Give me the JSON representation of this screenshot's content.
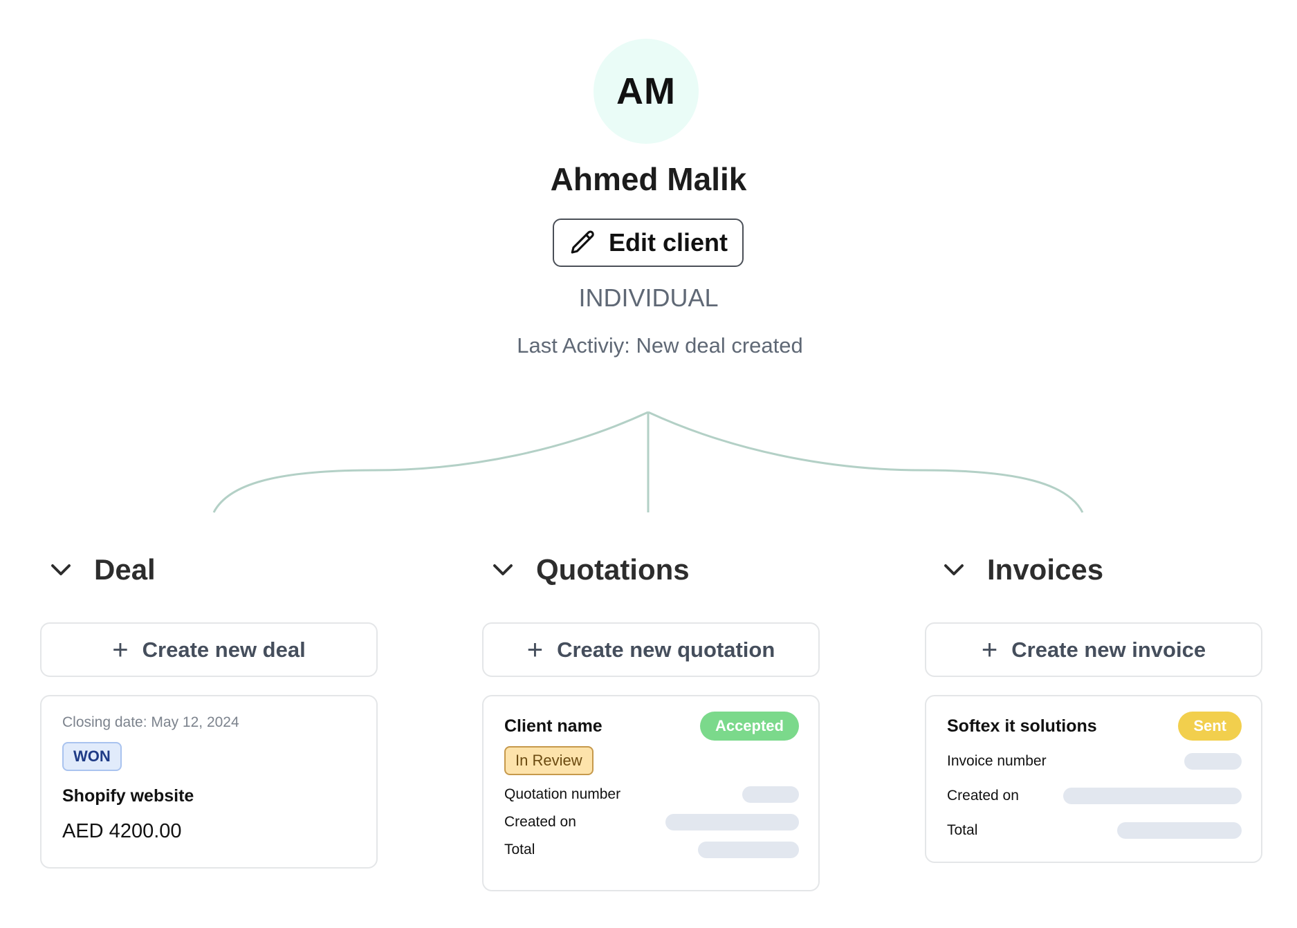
{
  "client": {
    "initials": "AM",
    "name": "Ahmed Malik",
    "edit_label": "Edit client",
    "type": "INDIVIDUAL",
    "last_activity": "Last Activiy: New deal created"
  },
  "colors": {
    "avatar_bg": "#eafcf7",
    "connector": "#b3d0c6",
    "accepted": "#7bd98b",
    "sent": "#f2cf4d",
    "in_review": "#fde3ab",
    "won": "#e1ebfb"
  },
  "deal": {
    "heading": "Deal",
    "create_label": "Create new deal",
    "card": {
      "closing_date": "Closing date: May 12, 2024",
      "status": "WON",
      "title": "Shopify website",
      "amount": "AED 4200.00"
    }
  },
  "quotations": {
    "heading": "Quotations",
    "create_label": "Create new quotation",
    "card": {
      "title": "Client name",
      "badge": "Accepted",
      "status": "In Review",
      "fields": [
        "Quotation number",
        "Created on",
        "Total"
      ]
    }
  },
  "invoices": {
    "heading": "Invoices",
    "create_label": "Create new invoice",
    "card": {
      "title": "Softex it solutions",
      "badge": "Sent",
      "fields": [
        "Invoice number",
        "Created on",
        "Total"
      ]
    }
  }
}
